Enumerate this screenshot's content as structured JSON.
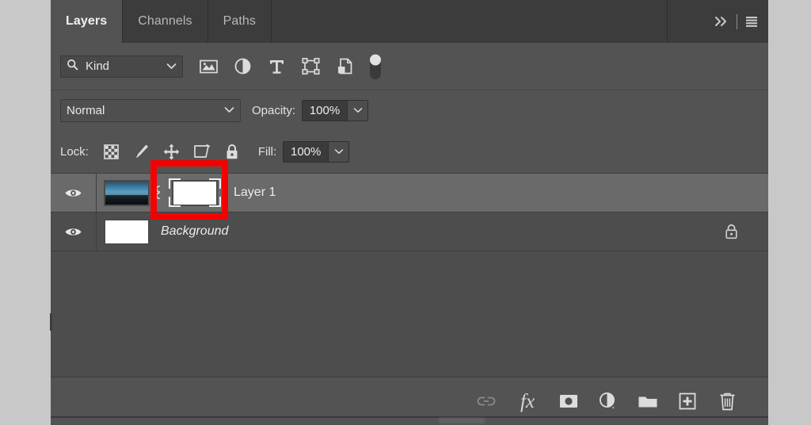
{
  "panel": {
    "title": "Layers",
    "tabs": [
      {
        "label": "Layers",
        "active": true
      },
      {
        "label": "Channels",
        "active": false
      },
      {
        "label": "Paths",
        "active": false
      }
    ],
    "header_icons": [
      {
        "name": "collapse-double-chevron-icon",
        "glyph": "»"
      },
      {
        "name": "panel-menu-icon",
        "glyph": "≡"
      }
    ]
  },
  "filter": {
    "search_icon": "search-icon",
    "kind_label": "Kind",
    "chevron": "chevron-down-icon",
    "type_filters": [
      {
        "name": "filter-pixel-layers-icon",
        "title": "Filter for pixel layers"
      },
      {
        "name": "filter-adjustment-layers-icon",
        "title": "Filter for adjustment layers"
      },
      {
        "name": "filter-type-layers-icon",
        "title": "Filter for type layers"
      },
      {
        "name": "filter-shape-layers-icon",
        "title": "Filter for shape layers"
      },
      {
        "name": "filter-smart-object-icon",
        "title": "Filter for smart objects"
      }
    ],
    "toggle_name": "filter-enable-toggle"
  },
  "blend": {
    "mode": "Normal",
    "opacity_caption": "Opacity:",
    "opacity_value": "100%"
  },
  "lock": {
    "caption": "Lock:",
    "items": [
      {
        "name": "lock-transparent-pixels-icon"
      },
      {
        "name": "lock-image-pixels-icon"
      },
      {
        "name": "lock-position-icon"
      },
      {
        "name": "lock-artboard-nesting-icon"
      },
      {
        "name": "lock-all-icon"
      }
    ],
    "fill_caption": "Fill:",
    "fill_value": "100%"
  },
  "layers": [
    {
      "name": "Layer 1",
      "visible": true,
      "selected": true,
      "italic": false,
      "thumbnail": "photo",
      "has_link": true,
      "has_mask": true,
      "mask_selected": true,
      "locked": false
    },
    {
      "name": "Background",
      "visible": true,
      "selected": false,
      "italic": true,
      "thumbnail": "white",
      "has_link": false,
      "has_mask": false,
      "mask_selected": false,
      "locked": true
    }
  ],
  "bottom_toolbar": [
    {
      "name": "link-layers-icon",
      "label": "Link layers",
      "disabled": true
    },
    {
      "name": "layer-style-fx-icon",
      "label": "fx",
      "disabled": false
    },
    {
      "name": "add-layer-mask-icon",
      "label": "Add layer mask",
      "disabled": false
    },
    {
      "name": "new-adjustment-layer-icon",
      "label": "New adjustment layer",
      "disabled": false
    },
    {
      "name": "new-group-icon",
      "label": "Create a new group",
      "disabled": false
    },
    {
      "name": "new-layer-icon",
      "label": "Create a new layer",
      "disabled": false
    },
    {
      "name": "delete-layer-icon",
      "label": "Delete layer",
      "disabled": false
    }
  ],
  "annotation": {
    "name": "red-highlight-box",
    "color": "#f40000",
    "target": "layer-mask-thumbnail"
  },
  "colors": {
    "outer_background": "#c8c8c8",
    "panel_background": "#535353",
    "list_background": "#4d4d4d",
    "selected_row": "#6a6a6a",
    "tab_inactive": "#3c3c3c",
    "text": "#ececec",
    "annotation_red": "#f40000"
  }
}
